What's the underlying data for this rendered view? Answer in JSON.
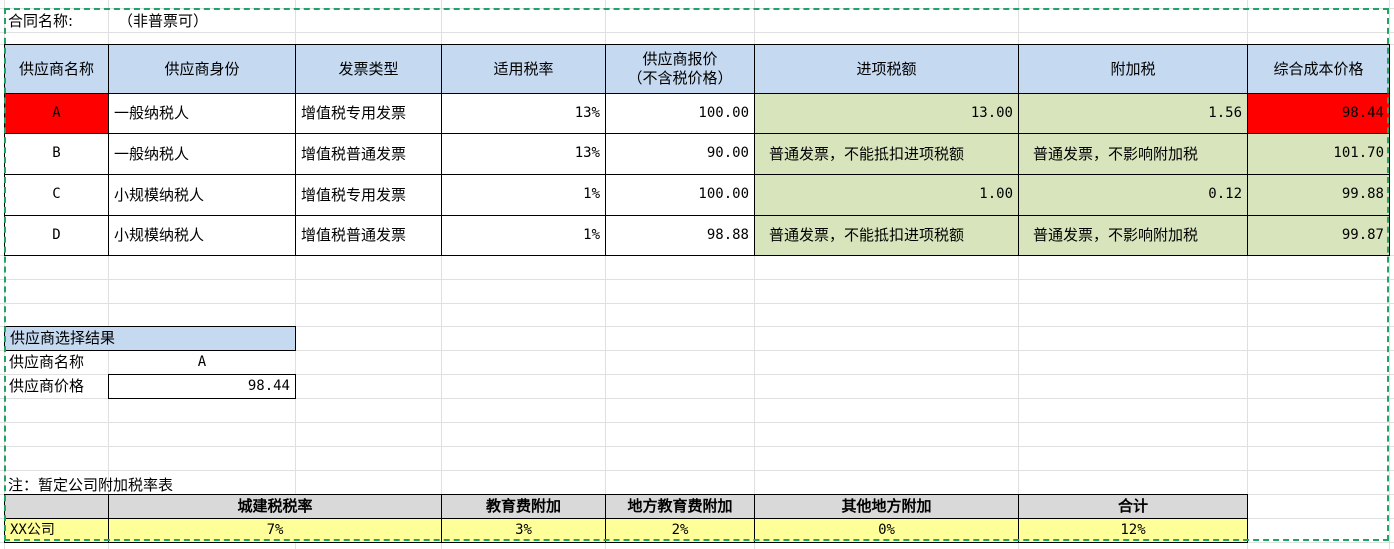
{
  "contract": {
    "label": "合同名称:",
    "value": "（非普票可）"
  },
  "headers": [
    "供应商名称",
    "供应商身份",
    "发票类型",
    "适用税率",
    "供应商报价\n（不含税价格）",
    "进项税额",
    "附加税",
    "综合成本价格"
  ],
  "header_quote_line1": "供应商报价",
  "header_quote_line2": "（不含税价格）",
  "rows": [
    {
      "name": "A",
      "identity": "一般纳税人",
      "invoice": "增值税专用发票",
      "rate": "13%",
      "quote": "100.00",
      "input_tax": "13.00",
      "surtax": "1.56",
      "cost": "98.44"
    },
    {
      "name": "B",
      "identity": "一般纳税人",
      "invoice": "增值税普通发票",
      "rate": "13%",
      "quote": "90.00",
      "input_tax": "普通发票，不能抵扣进项税额",
      "surtax": "普通发票，不影响附加税",
      "cost": "101.70"
    },
    {
      "name": "C",
      "identity": "小规模纳税人",
      "invoice": "增值税专用发票",
      "rate": "1%",
      "quote": "100.00",
      "input_tax": "1.00",
      "surtax": "0.12",
      "cost": "99.88"
    },
    {
      "name": "D",
      "identity": "小规模纳税人",
      "invoice": "增值税普通发票",
      "rate": "1%",
      "quote": "98.88",
      "input_tax": "普通发票，不能抵扣进项税额",
      "surtax": "普通发票，不影响附加税",
      "cost": "99.87"
    }
  ],
  "result": {
    "title": "供应商选择结果",
    "name_label": "供应商名称",
    "name_value": "A",
    "price_label": "供应商价格",
    "price_value": "98.44"
  },
  "surtax_table": {
    "note": "注：暂定公司附加税率表",
    "headers": [
      "城建税税率",
      "教育费附加",
      "地方教育费附加",
      "其他地方附加",
      "合计"
    ],
    "company": "XX公司",
    "values": [
      "7%",
      "3%",
      "2%",
      "0%",
      "12%"
    ]
  },
  "colors": {
    "header": "#c5d9f1",
    "green": "#d8e4bc",
    "red": "#ff0000",
    "yellow": "#ffff99",
    "selection": "#21a366"
  }
}
